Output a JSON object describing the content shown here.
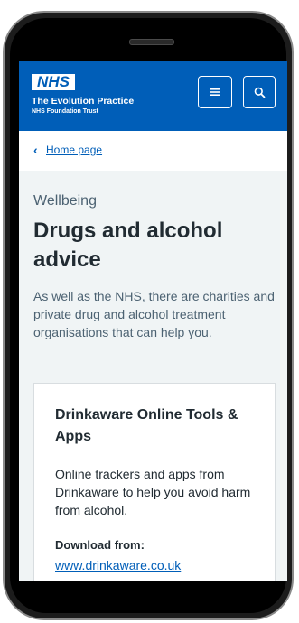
{
  "header": {
    "logo_text": "NHS",
    "org_name": "The Evolution Practice",
    "org_subtitle": "NHS Foundation Trust",
    "menu_icon": "hamburger-icon",
    "search_icon": "search-icon"
  },
  "breadcrumb": {
    "link_label": "Home page"
  },
  "page": {
    "eyebrow": "Wellbeing",
    "title": "Drugs and alcohol advice",
    "lede": "As well as the NHS, there are charities and private drug and alcohol treatment organisations that can help you."
  },
  "card": {
    "title": "Drinkaware Online Tools & Apps",
    "text": "Online trackers and apps from Drinkaware to help you avoid harm from alcohol.",
    "download_label": "Download from:",
    "link_text": "www.drinkaware.co.uk"
  },
  "colors": {
    "nhs_blue": "#005eb8",
    "page_bg": "#f0f4f5",
    "text_dark": "#212b32",
    "text_secondary": "#4c6272"
  }
}
